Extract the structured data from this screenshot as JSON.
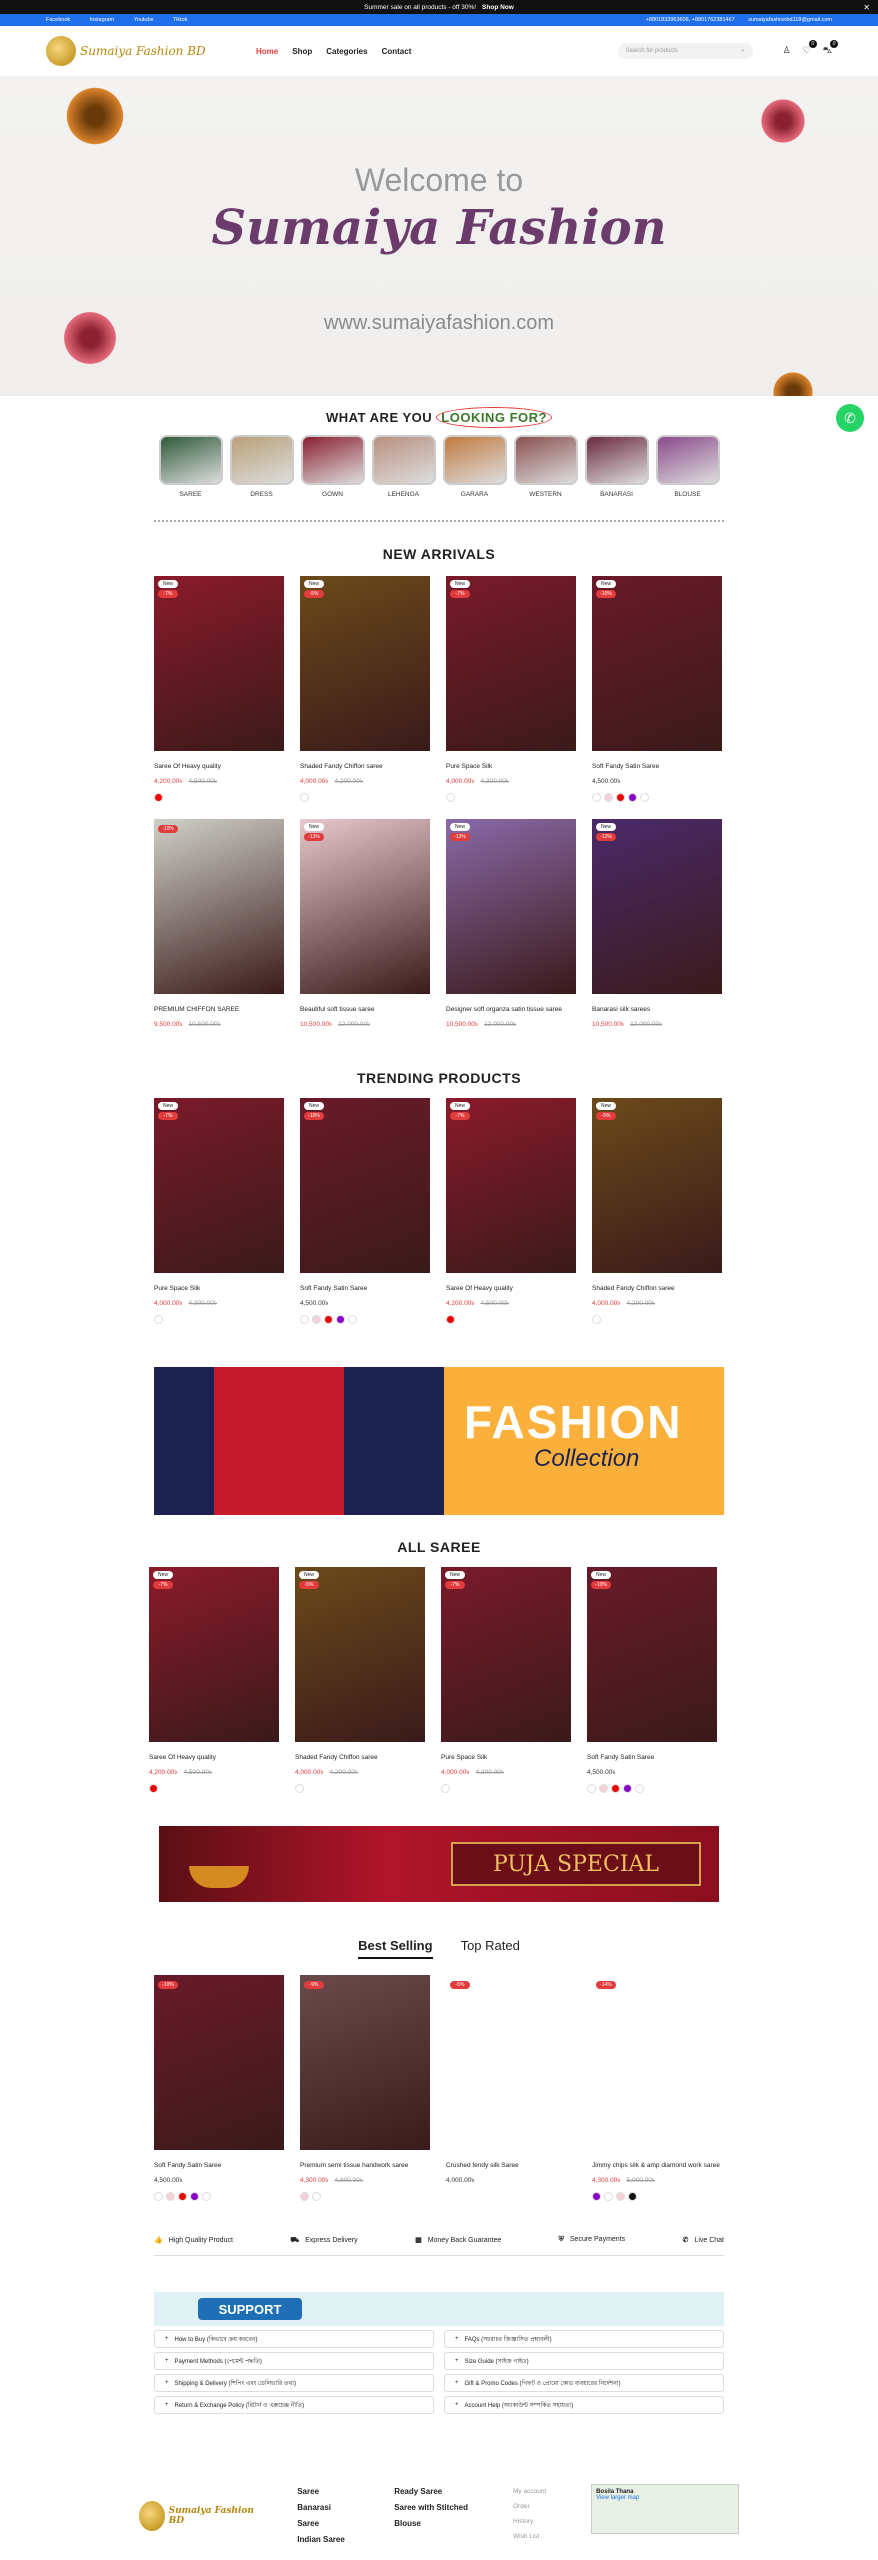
{
  "topbar": {
    "text": "Summer sale on all products - off 30%!",
    "cta": "Shop Now",
    "close": "✕"
  },
  "socialbar": {
    "links": [
      "Facebook",
      "Instagram",
      "Youtube",
      "Tiktok"
    ],
    "phone": "+8801833963606, +8801762381467",
    "email": "sumaiyafashionbd118@gmail.com"
  },
  "header": {
    "logo_text": "Sumaiya Fashion BD",
    "nav": [
      "Home",
      "Shop",
      "Categories",
      "Contact"
    ],
    "search_placeholder": "Search for products",
    "wishlist_count": "0",
    "cart_count": "0"
  },
  "hero": {
    "welcome": "Welcome to",
    "brand": "Sumaiya Fashion",
    "url": "www.sumaiyafashion.com"
  },
  "lookfor": {
    "prefix": "WHAT ARE YOU",
    "highlight": "LOOKING FOR?"
  },
  "categories": [
    "SAREE",
    "DRESS",
    "GOWN",
    "LEHENGA",
    "GARARA",
    "WESTERN",
    "BANARASI",
    "BLOUSE"
  ],
  "new_arrivals": {
    "title": "NEW ARRIVALS",
    "products": [
      {
        "name": "Saree Of Heavy quality",
        "price": "4,200.00৳",
        "old": "4,500.00৳",
        "new": "New",
        "disc": "-7%",
        "img": "#8b1a2b"
      },
      {
        "name": "Shaded Fandy Chiffon saree",
        "price": "4,000.00৳",
        "old": "4,200.00৳",
        "new": "New",
        "disc": "-5%",
        "img": "#6b4a1a"
      },
      {
        "name": "Pure Space Silk",
        "price": "4,000.00৳",
        "old": "4,300.00৳",
        "new": "New",
        "disc": "-7%",
        "img": "#7a1a2a"
      },
      {
        "name": "Soft Fandy Satin Saree",
        "price": "4,500.00৳",
        "old": "",
        "new": "New",
        "disc": "-10%",
        "img": "#6a1a2a"
      },
      {
        "name": "PREMIUM CHIFFON SAREE",
        "price": "9,500.00৳",
        "old": "10,500.00৳",
        "new": "",
        "disc": "-10%",
        "img": "#cfd0c8"
      },
      {
        "name": "Beautiful soft tissue saree",
        "price": "10,500.00৳",
        "old": "12,000.00৳",
        "new": "New",
        "disc": "-13%",
        "img": "#e8c8cc"
      },
      {
        "name": "Designer soft organza satin tissue saree",
        "price": "10,500.00৳",
        "old": "12,000.00৳",
        "new": "New",
        "disc": "-13%",
        "img": "#8a6aa8"
      },
      {
        "name": "Banarasi silk sarees",
        "price": "10,500.00৳",
        "old": "12,000.00৳",
        "new": "New",
        "disc": "-13%",
        "img": "#4a2a6a"
      }
    ]
  },
  "trending": {
    "title": "TRENDING PRODUCTS",
    "products": [
      {
        "name": "Pure Space Silk",
        "price": "4,000.00৳",
        "old": "4,300.00৳",
        "new": "New",
        "disc": "-7%",
        "img": "#7a1a2a"
      },
      {
        "name": "Soft Fandy Satin Saree",
        "price": "4,500.00৳",
        "old": "",
        "new": "New",
        "disc": "-10%",
        "img": "#6a1a2a"
      },
      {
        "name": "Saree Of Heavy quality",
        "price": "4,200.00৳",
        "old": "4,500.00৳",
        "new": "New",
        "disc": "-7%",
        "img": "#8b1a2b"
      },
      {
        "name": "Shaded Fandy Chiffon saree",
        "price": "4,000.00৳",
        "old": "4,200.00৳",
        "new": "New",
        "disc": "-5%",
        "img": "#6b4a1a"
      }
    ]
  },
  "banner_fashion": {
    "title": "FASHION",
    "subtitle": "Collection"
  },
  "all_saree": {
    "title": "ALL SAREE",
    "products": [
      {
        "name": "Saree Of Heavy quality",
        "price": "4,200.00৳",
        "old": "4,500.00৳",
        "new": "New",
        "disc": "-7%",
        "img": "#8b1a2b"
      },
      {
        "name": "Shaded Fandy Chiffon saree",
        "price": "4,000.00৳",
        "old": "4,200.00৳",
        "new": "New",
        "disc": "-5%",
        "img": "#6b4a1a"
      },
      {
        "name": "Pure Space Silk",
        "price": "4,000.00৳",
        "old": "4,300.00৳",
        "new": "New",
        "disc": "-7%",
        "img": "#7a1a2a"
      },
      {
        "name": "Soft Fandy Satin Saree",
        "price": "4,500.00৳",
        "old": "",
        "new": "New",
        "disc": "-10%",
        "img": "#6a1a2a"
      }
    ]
  },
  "banner_puja": {
    "text": "PUJA SPECIAL"
  },
  "tabs": [
    "Best Selling",
    "Top Rated"
  ],
  "best_selling": [
    {
      "name": "Soft Fandy Satin Saree",
      "price": "4,500.00৳",
      "old": "",
      "disc": "-10%",
      "img": "#6a1a2a"
    },
    {
      "name": "Premium semi tissue handwork saree",
      "price": "4,300.00৳",
      "old": "4,800.00৳",
      "disc": "-9%",
      "img": "#6a4a4a"
    },
    {
      "name": "Crushed fendy silk Saree",
      "price": "4,000.00৳",
      "old": "",
      "disc": "-5%",
      "img": "#ffffff"
    },
    {
      "name": "Jimmy chips silk & amp diamond work saree",
      "price": "4,300.00৳",
      "old": "5,000.00৳",
      "disc": "-14%",
      "img": "#ffffff"
    }
  ],
  "features": [
    "High Quality Product",
    "Express Delivery",
    "Money Back Guarantee",
    "Secure Payments",
    "Live Chat"
  ],
  "support": {
    "label": "SUPPORT"
  },
  "faq": [
    "How to Buy (কিভাবে ক্রয় করবেন)",
    "FAQs (সচরাচর জিজ্ঞাসিত প্রশ্নাবলী)",
    "Payment Methods (পেমেন্ট পদ্ধতি)",
    "Size Guide (সাইজ গাইড)",
    "Shipping & Delivery (শিপিং এবং ডেলিভারি তথ্য)",
    "Gift & Promo Codes (গিফট ও প্রোমো কোড ব্যবহারের নির্দেশনা)",
    "Return & Exchange Policy (রিটার্ন ও এক্সচেঞ্জ নীতি)",
    "Account Help (অ্যাকাউন্ট সম্পর্কিত সহায়তা)"
  ],
  "footer": {
    "col1": [
      "Saree",
      "Banarasi Saree",
      "Indian Saree"
    ],
    "col2": [
      "Ready Saree",
      "Saree with Stitched Blouse"
    ],
    "col3": [
      "My account",
      "Order History",
      "Wish List"
    ],
    "map": {
      "place": "Bosila Thana",
      "link": "View larger map"
    }
  }
}
